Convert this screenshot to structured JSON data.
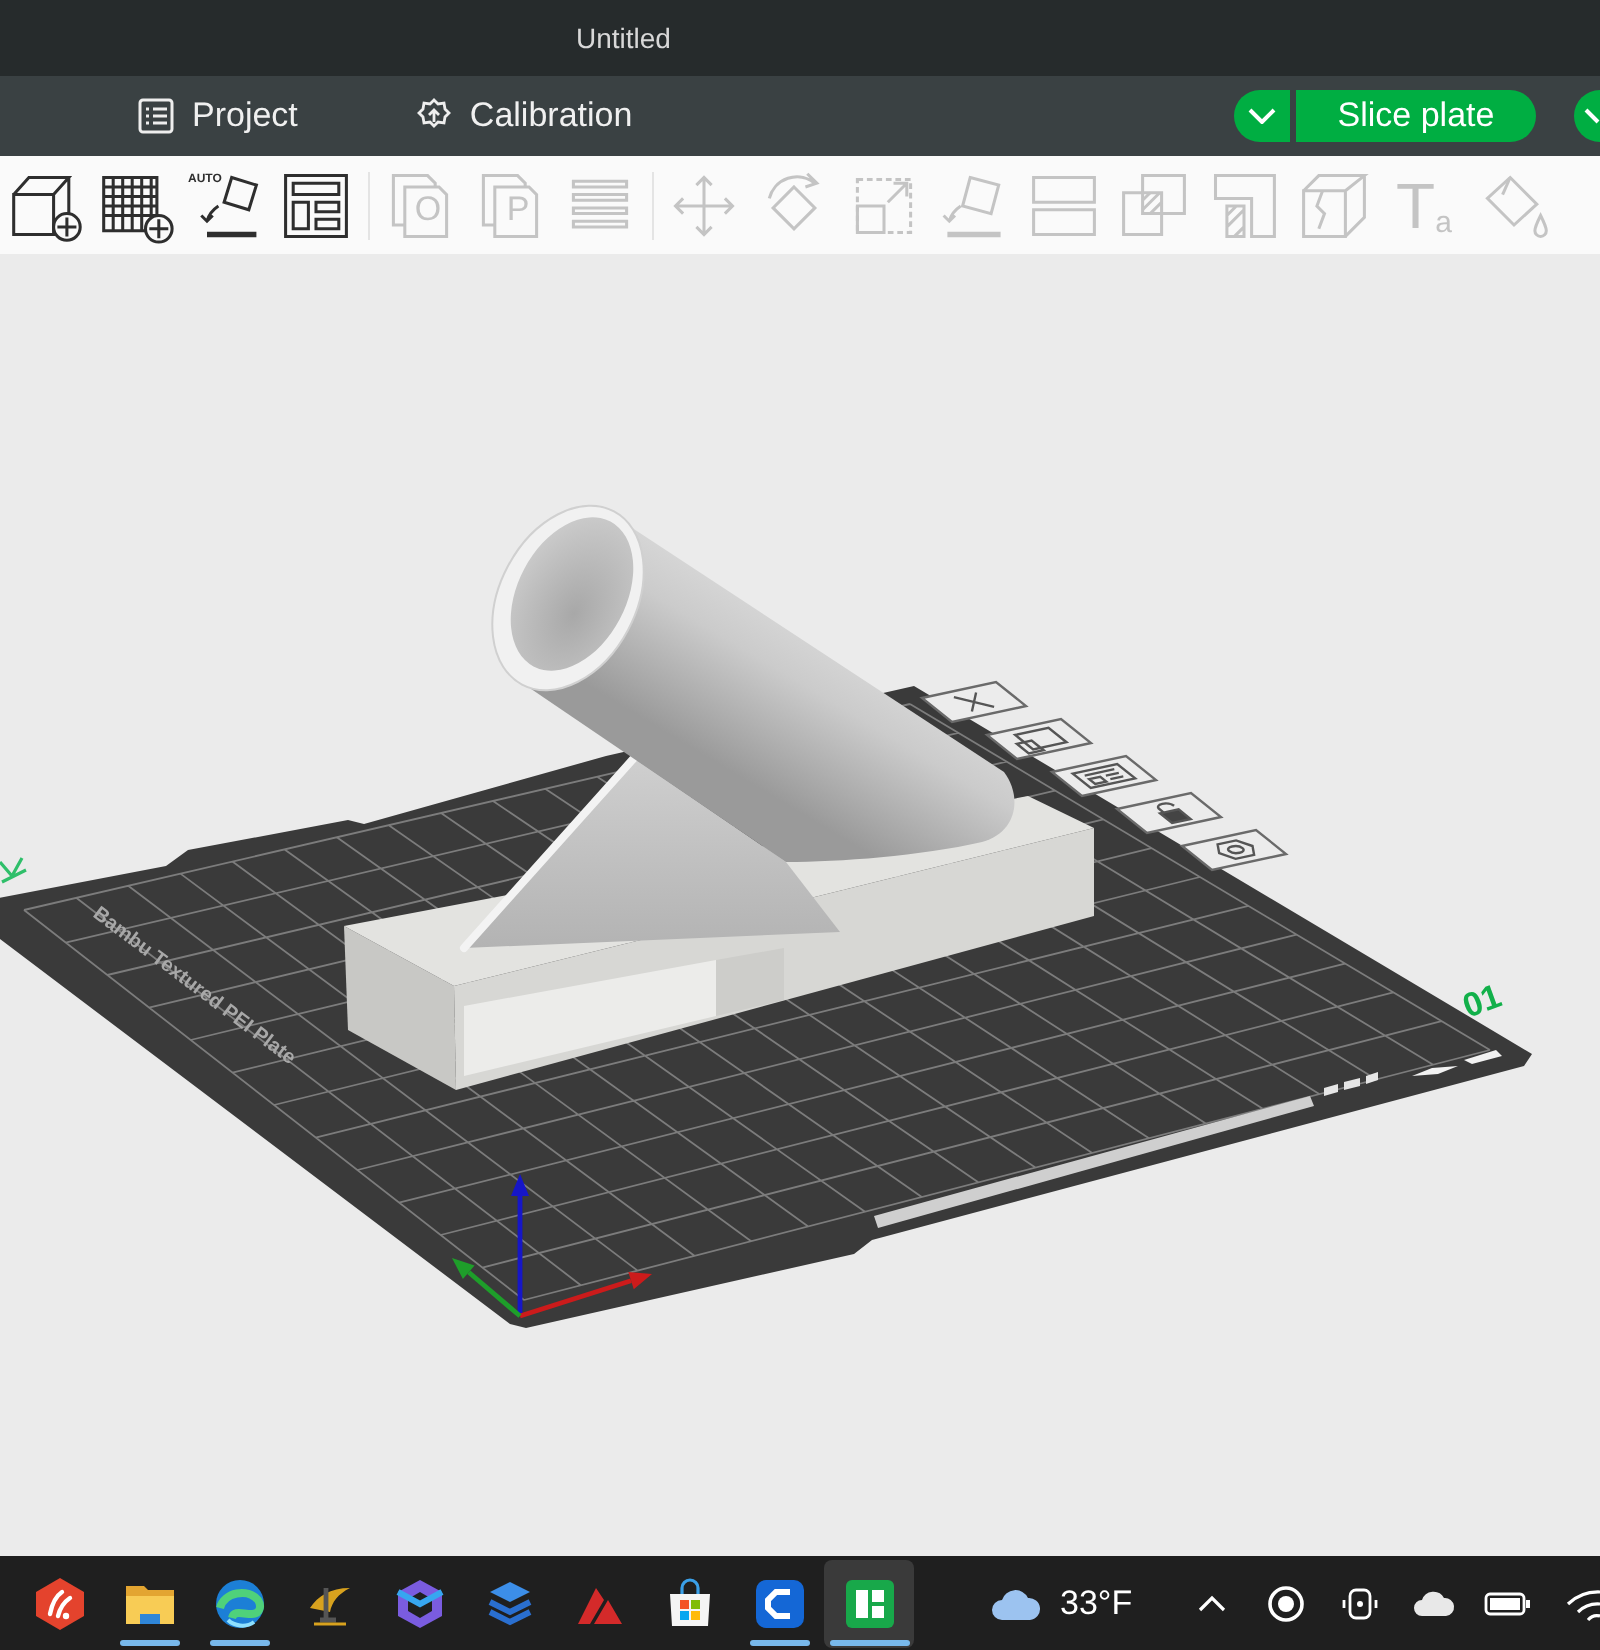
{
  "window": {
    "title": "Untitled"
  },
  "menu_bar": {
    "tabs": [
      {
        "kind": "list",
        "label": "Project",
        "selected": false
      },
      {
        "kind": "gear",
        "label": "Calibration",
        "selected": false
      }
    ],
    "slice_button": {
      "label": "Slice plate"
    }
  },
  "toolbar": {
    "groups": [
      {
        "tools": [
          {
            "kind": "cube",
            "disabled": false
          },
          {
            "kind": "grid",
            "disabled": false
          },
          {
            "kind": "orient",
            "glyph": "AUTO",
            "disabled": false
          },
          {
            "kind": "layout",
            "disabled": false
          }
        ]
      },
      {
        "tools": [
          {
            "kind": "objects",
            "glyph": "O",
            "disabled": true
          },
          {
            "kind": "parts",
            "glyph": "P",
            "disabled": true
          },
          {
            "kind": "layers",
            "disabled": true
          }
        ]
      },
      {
        "tools": [
          {
            "kind": "move",
            "disabled": true
          },
          {
            "kind": "rotate",
            "disabled": true
          },
          {
            "kind": "scale",
            "disabled": true
          },
          {
            "kind": "flatten",
            "disabled": true
          },
          {
            "kind": "cut",
            "disabled": true
          },
          {
            "kind": "boolean",
            "disabled": true
          },
          {
            "kind": "support",
            "disabled": true
          },
          {
            "kind": "seam",
            "disabled": true
          },
          {
            "kind": "text",
            "glyph": "T$_{a}$",
            "disabled": true
          },
          {
            "kind": "paint",
            "disabled": true
          }
        ]
      }
    ]
  },
  "viewport": {
    "plate": {
      "label": "Bambu Textured PEI Plate",
      "number": "01",
      "tools": [
        {
          "kind": "close"
        },
        {
          "kind": "arrange"
        },
        {
          "kind": "layout"
        },
        {
          "kind": "lock"
        },
        {
          "kind": "settings"
        }
      ]
    }
  },
  "taskbar": {
    "apps": [
      {
        "kind": "hexagon",
        "running": false,
        "selected": false
      },
      {
        "kind": "folder",
        "running": true,
        "selected": false
      },
      {
        "kind": "swirl",
        "running": true,
        "selected": false
      },
      {
        "kind": "emblem",
        "running": false,
        "selected": false
      },
      {
        "kind": "ribbon",
        "running": false,
        "selected": false
      },
      {
        "kind": "layers",
        "running": false,
        "selected": false
      },
      {
        "kind": "peaks",
        "running": false,
        "selected": false
      },
      {
        "kind": "store",
        "running": false,
        "selected": false
      },
      {
        "kind": "bracket",
        "running": true,
        "selected": false
      },
      {
        "kind": "block",
        "running": true,
        "selected": true
      }
    ],
    "weather": {
      "temperature": "33°F"
    },
    "tray": [
      {
        "kind": "chevron"
      },
      {
        "kind": "record"
      },
      {
        "kind": "camera"
      },
      {
        "kind": "cloud"
      },
      {
        "kind": "battery"
      },
      {
        "kind": "wifi"
      }
    ]
  }
}
